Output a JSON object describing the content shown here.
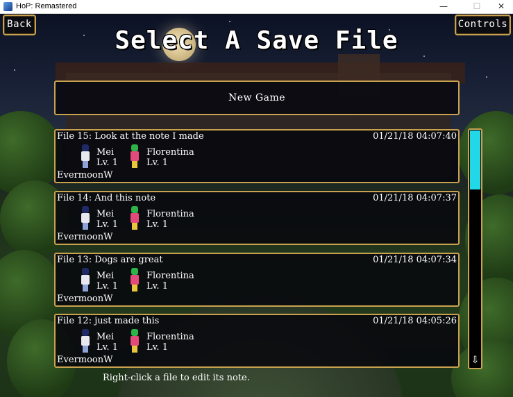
{
  "window": {
    "title": "HoP: Remastered",
    "minimize": "—",
    "maximize": "☐",
    "close": "✕"
  },
  "nav": {
    "back_label": "Back",
    "controls_label": "Controls"
  },
  "heading": "Select A Save File",
  "new_game_label": "New Game",
  "save_files": [
    {
      "title": "File 15: Look at the note I made",
      "date": "01/21/18 04:07:40",
      "party": [
        {
          "name": "Mei",
          "level": "Lv. 1"
        },
        {
          "name": "Florentina",
          "level": "Lv. 1"
        }
      ],
      "location": "EvermoonW"
    },
    {
      "title": "File 14: And this note",
      "date": "01/21/18 04:07:37",
      "party": [
        {
          "name": "Mei",
          "level": "Lv. 1"
        },
        {
          "name": "Florentina",
          "level": "Lv. 1"
        }
      ],
      "location": "EvermoonW"
    },
    {
      "title": "File 13: Dogs are great",
      "date": "01/21/18 04:07:34",
      "party": [
        {
          "name": "Mei",
          "level": "Lv. 1"
        },
        {
          "name": "Florentina",
          "level": "Lv. 1"
        }
      ],
      "location": "EvermoonW"
    },
    {
      "title": "File 12: just made this",
      "date": "01/21/18 04:05:26",
      "party": [
        {
          "name": "Mei",
          "level": "Lv. 1"
        },
        {
          "name": "Florentina",
          "level": "Lv. 1"
        }
      ],
      "location": "EvermoonW"
    }
  ],
  "scrollbar": {
    "down_arrow": "⇩"
  },
  "hint": "Right-click a file to edit its note.",
  "colors": {
    "border_gold": "#c9a24f",
    "scroll_thumb": "#22d8e8"
  }
}
